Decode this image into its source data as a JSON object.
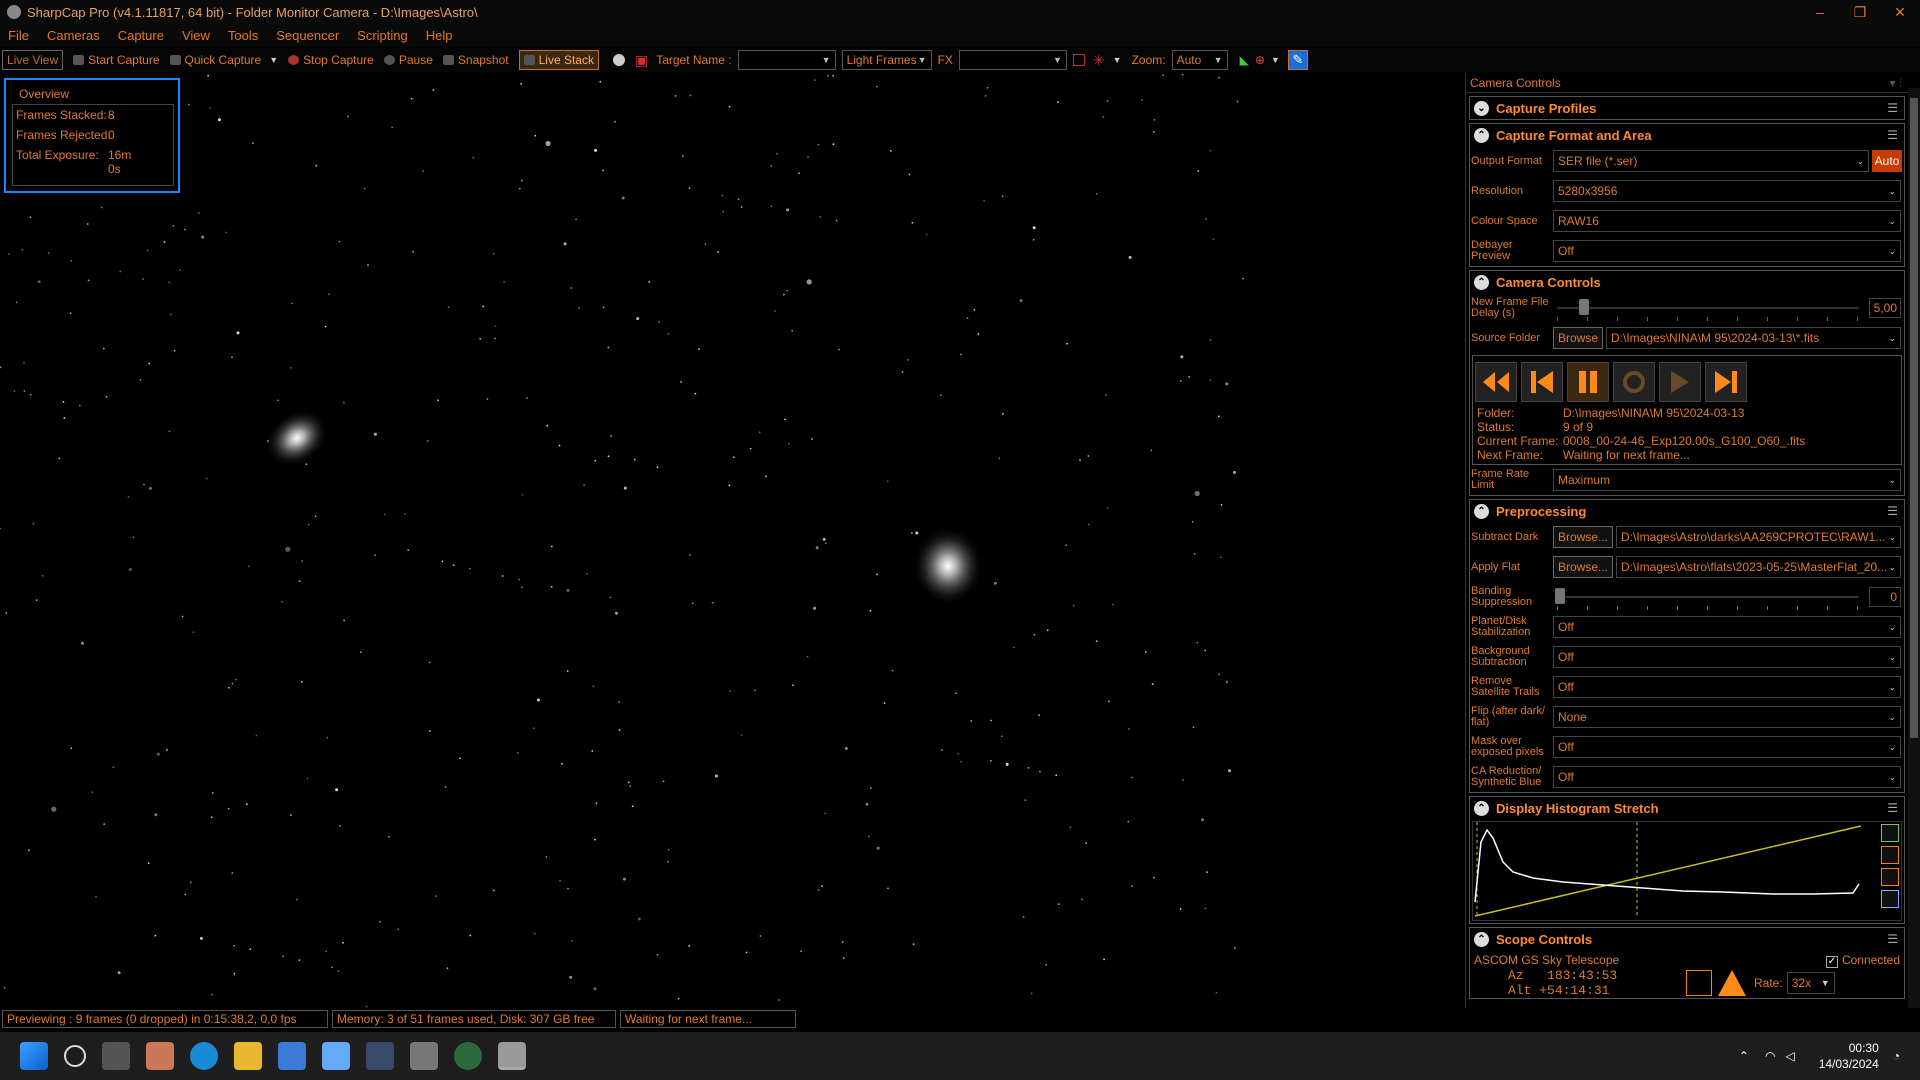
{
  "window": {
    "title": "SharpCap Pro (v4.1.11817, 64 bit) - Folder Monitor Camera - D:\\Images\\Astro\\",
    "controls": [
      "–",
      "❐",
      "✕"
    ]
  },
  "menu": [
    "File",
    "Cameras",
    "Capture",
    "View",
    "Tools",
    "Sequencer",
    "Scripting",
    "Help"
  ],
  "toolbar": {
    "live_view": "Live View",
    "start_capture": "Start Capture",
    "quick_capture": "Quick Capture",
    "stop_capture": "Stop Capture",
    "pause": "Pause",
    "snapshot": "Snapshot",
    "live_stack": "Live Stack",
    "target_name_label": "Target Name :",
    "target_name_value": "",
    "frame_type": "Light Frames",
    "fx_label": "FX",
    "fx_value": "",
    "zoom_label": "Zoom:",
    "zoom_value": "Auto"
  },
  "overview": {
    "title": "Overview",
    "frames_stacked_label": "Frames Stacked:",
    "frames_stacked_value": "8",
    "frames_rejected_label": "Frames Rejected:",
    "frames_rejected_value": "0",
    "total_exposure_label": "Total Exposure:",
    "total_exposure_value": "16m 0s"
  },
  "panel": {
    "title": "Camera Controls",
    "capture_profiles": "Capture Profiles",
    "capture_format": {
      "title": "Capture Format and Area",
      "output_format_label": "Output Format",
      "output_format_value": "SER file (*.ser)",
      "auto_label": "Auto",
      "resolution_label": "Resolution",
      "resolution_value": "5280x3956",
      "colour_space_label": "Colour Space",
      "colour_space_value": "RAW16",
      "debayer_label": "Debayer Preview",
      "debayer_value": "Off"
    },
    "camera_controls": {
      "title": "Camera Controls",
      "delay_label": "New Frame File Delay (s)",
      "delay_value": "5,00",
      "delay_fraction": 0.1,
      "source_folder_label": "Source Folder",
      "browse_label": "Browse",
      "source_folder_value": "D:\\Images\\NINA\\M 95\\2024-03-13\\*.fits",
      "folder_label": "Folder:",
      "folder_value": "D:\\Images\\NINA\\M 95\\2024-03-13",
      "status_label": "Status:",
      "status_value": "9 of 9",
      "current_frame_label": "Current Frame:",
      "current_frame_value": "0008_00-24-46_Exp120.00s_G100_O60_.fits",
      "next_frame_label": "Next Frame:",
      "next_frame_value": "Waiting for next frame...",
      "frame_rate_label": "Frame Rate Limit",
      "frame_rate_value": "Maximum"
    },
    "preprocessing": {
      "title": "Preprocessing",
      "subtract_dark_label": "Subtract Dark",
      "browse_label": "Browse...",
      "subtract_dark_value": "D:\\Images\\Astro\\darks\\AA269CPROTEC\\RAW1...",
      "apply_flat_label": "Apply Flat",
      "apply_flat_value": "D:\\Images\\Astro\\flats\\2023-05-25\\MasterFlat_20...",
      "banding_label": "Banding Suppression",
      "banding_value": "0",
      "planet_label": "Planet/Disk Stabilization",
      "planet_value": "Off",
      "background_label": "Background Subtraction",
      "background_value": "Off",
      "satellite_label": "Remove Satellite Trails",
      "satellite_value": "Off",
      "flip_label": "Flip (after dark/ flat)",
      "flip_value": "None",
      "mask_label": "Mask over exposed pixels",
      "mask_value": "Off",
      "ca_label": "CA Reduction/ Synthetic Blue",
      "ca_value": "Off"
    },
    "histogram": {
      "title": "Display Histogram Stretch"
    },
    "scope": {
      "title": "Scope Controls",
      "telescope": "ASCOM GS Sky Telescope",
      "connected_label": "Connected",
      "az_label": "Az",
      "az_value": "183:43:53",
      "alt_label": "Alt",
      "alt_value": "+54:14:31",
      "rate_label": "Rate:",
      "rate_value": "32x"
    }
  },
  "statusbar": {
    "preview": "Previewing : 9 frames (0 dropped) in 0:15:38,2, 0,0 fps",
    "memory": "Memory: 3 of 51 frames used, Disk: 307 GB free",
    "waiting": "Waiting for next frame..."
  },
  "taskbar": {
    "time": "00:30",
    "date": "14/03/2024"
  },
  "colors": {
    "accent": "#e07a2a",
    "overview_border": "#1a88ff",
    "auto_button": "#c83a00"
  }
}
